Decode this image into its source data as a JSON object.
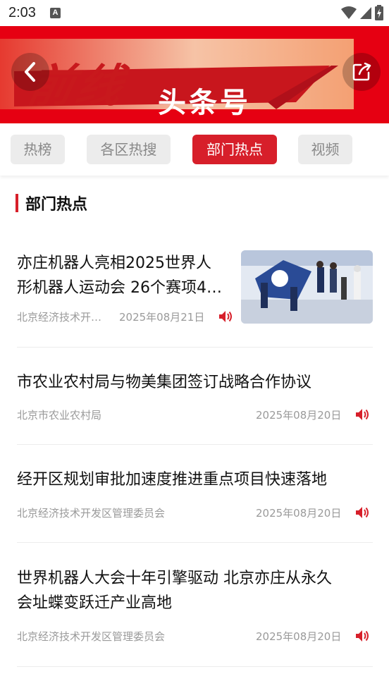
{
  "status_bar": {
    "time": "2:03",
    "notification_icon": "A"
  },
  "banner": {
    "calligraphy_title": "前线",
    "subtitle": "头条号",
    "background_color": "#e60012"
  },
  "tabs": [
    {
      "label": "热榜",
      "active": false
    },
    {
      "label": "各区热搜",
      "active": false
    },
    {
      "label": "部门热点",
      "active": true
    },
    {
      "label": "视频",
      "active": false
    }
  ],
  "section": {
    "title": "部门热点",
    "accent_color": "#d71f2a"
  },
  "news": [
    {
      "title_line1": "亦庄机器人亮相2025世界人",
      "title_line2": "形机器人运动会 26个赛项4…",
      "source": "北京经济技术开…",
      "date": "2025年08月21日",
      "has_thumbnail": true
    },
    {
      "title": "市农业农村局与物美集团签订战略合作协议",
      "source": "北京市农业农村局",
      "date": "2025年08月20日"
    },
    {
      "title": "经开区规划审批加速度推进重点项目快速落地",
      "source": "北京经济技术开发区管理委员会",
      "date": "2025年08月20日"
    },
    {
      "title_line1": "世界机器人大会十年引擎驱动 北京亦庄从永久",
      "title_line2": "会址蝶变跃迁产业高地",
      "source": "北京经济技术开发区管理委员会",
      "date": "2025年08月20日"
    }
  ]
}
